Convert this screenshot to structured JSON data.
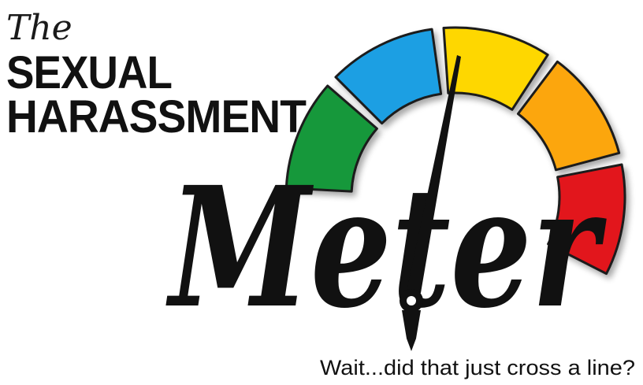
{
  "logo": {
    "line_the": "The",
    "line_sexual": "SEXUAL",
    "line_harassment": "HARASSMENT",
    "word_meter": "Meter",
    "tagline": "Wait...did that just cross a line?"
  },
  "gauge": {
    "segments": [
      {
        "name": "green",
        "color": "#14983a"
      },
      {
        "name": "blue",
        "color": "#1d9fe3"
      },
      {
        "name": "yellow",
        "color": "#fed700"
      },
      {
        "name": "orange",
        "color": "#fca611"
      },
      {
        "name": "red",
        "color": "#e2141c"
      }
    ],
    "outline_color": "#1a1a1a",
    "needle_color": "#111111"
  }
}
